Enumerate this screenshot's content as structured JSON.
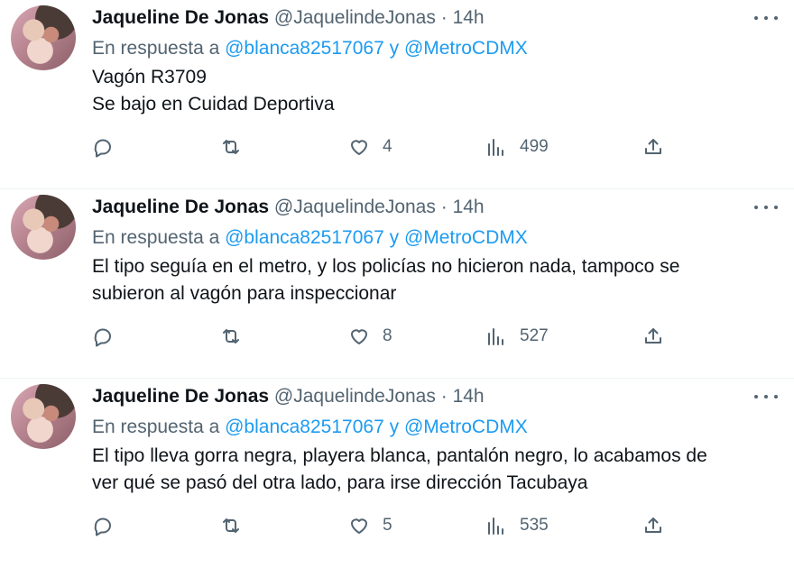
{
  "tweets": [
    {
      "name": "Jaqueline De Jonas",
      "handle": "@JaquelindeJonas",
      "separator": "·",
      "time": "14h",
      "reply_prefix": "En respuesta a",
      "mention1": "@blanca82517067",
      "reply_and": "y",
      "mention2": "@MetroCDMX",
      "lines": [
        "Vagón R3709",
        "Se bajo en Cuidad Deportiva"
      ],
      "likes": "4",
      "views": "499"
    },
    {
      "name": "Jaqueline De Jonas",
      "handle": "@JaquelindeJonas",
      "separator": "·",
      "time": "14h",
      "reply_prefix": "En respuesta a",
      "mention1": "@blanca82517067",
      "reply_and": "y",
      "mention2": "@MetroCDMX",
      "lines": [
        "El tipo seguía en el metro, y los policías no hicieron nada, tampoco se",
        "subieron al vagón para inspeccionar"
      ],
      "likes": "8",
      "views": "527"
    },
    {
      "name": "Jaqueline De Jonas",
      "handle": "@JaquelindeJonas",
      "separator": "·",
      "time": "14h",
      "reply_prefix": "En respuesta a",
      "mention1": "@blanca82517067",
      "reply_and": "y",
      "mention2": "@MetroCDMX",
      "lines": [
        "El tipo lleva gorra negra, playera blanca, pantalón negro, lo acabamos de",
        "ver qué se pasó del otra lado, para irse dirección Tacubaya"
      ],
      "likes": "5",
      "views": "535"
    }
  ],
  "icons": {
    "reply": "reply-icon",
    "retweet": "retweet-icon",
    "like": "heart-icon",
    "views": "views-icon",
    "share": "share-icon",
    "more": "more-icon"
  },
  "colors": {
    "link": "#1d9bf0",
    "secondary_text": "#536471",
    "primary_text": "#0f1419"
  }
}
